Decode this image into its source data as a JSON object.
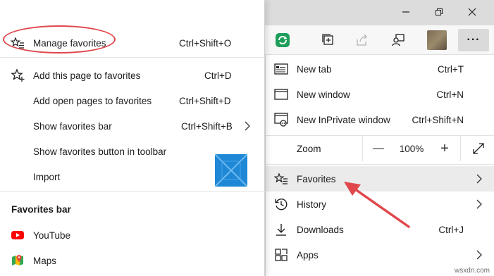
{
  "favorites_menu": {
    "items": [
      {
        "label": "Manage favorites",
        "shortcut": "Ctrl+Shift+O",
        "icon": "star-list-icon"
      },
      {
        "label": "Add this page to favorites",
        "shortcut": "Ctrl+D",
        "icon": "star-add-icon"
      },
      {
        "label": "Add open pages to favorites",
        "shortcut": "Ctrl+Shift+D"
      },
      {
        "label": "Show favorites bar",
        "shortcut": "Ctrl+Shift+B",
        "has_submenu": true
      },
      {
        "label": "Show favorites button in toolbar",
        "shortcut": ""
      },
      {
        "label": "Import",
        "shortcut": ""
      }
    ],
    "bar_heading": "Favorites bar",
    "bar_items": [
      {
        "label": "YouTube",
        "icon": "youtube-icon"
      },
      {
        "label": "Maps",
        "icon": "maps-icon"
      }
    ]
  },
  "main_menu": {
    "new_tab": {
      "label": "New tab",
      "shortcut": "Ctrl+T"
    },
    "new_window": {
      "label": "New window",
      "shortcut": "Ctrl+N"
    },
    "new_inprivate": {
      "label": "New InPrivate window",
      "shortcut": "Ctrl+Shift+N"
    },
    "zoom": {
      "label": "Zoom",
      "value": "100%",
      "minus": "—",
      "plus": "+"
    },
    "favorites": {
      "label": "Favorites"
    },
    "history": {
      "label": "History"
    },
    "downloads": {
      "label": "Downloads",
      "shortcut": "Ctrl+J"
    },
    "apps": {
      "label": "Apps"
    }
  },
  "toolbar": {
    "more_label": "···"
  },
  "watermark": "wsxdn.com",
  "colors": {
    "highlight_ellipse": "#e0474c",
    "arrow": "#e0474c",
    "youtube": "#ff0000",
    "extension_green": "#1e9e5a",
    "win_logo": "#1e88d6"
  }
}
